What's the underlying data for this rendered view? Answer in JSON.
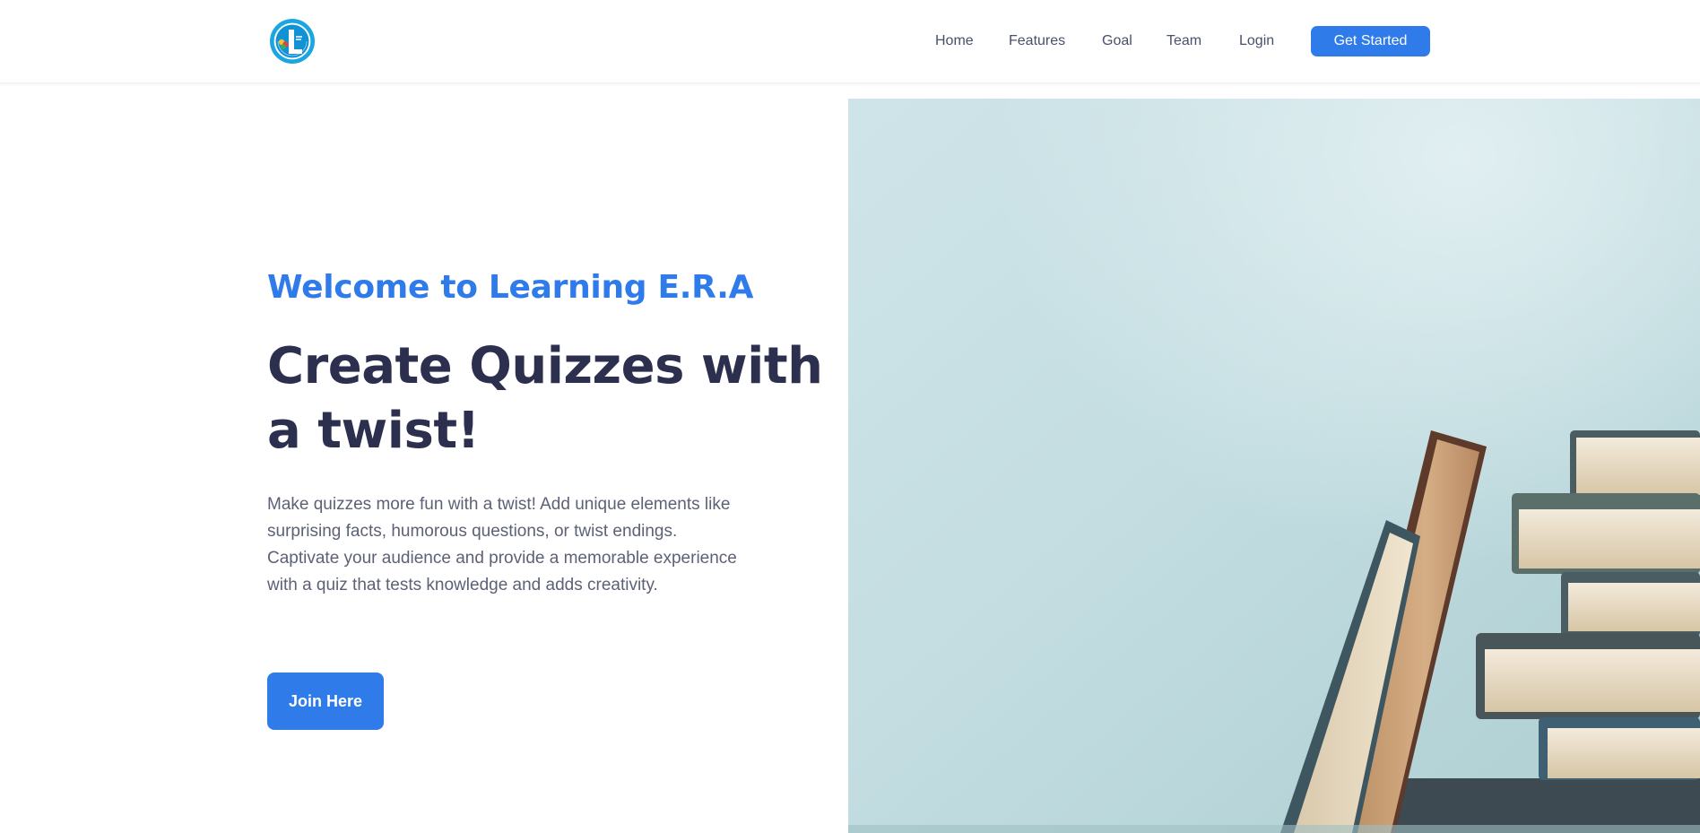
{
  "header": {
    "logo_icon": "learning-era-logo",
    "nav": {
      "home": "Home",
      "features": "Features",
      "goal": "Goal",
      "team": "Team",
      "login": "Login"
    },
    "cta_label": "Get Started"
  },
  "hero": {
    "welcome": "Welcome to Learning E.R.A",
    "headline": "Create Quizzes with a twist!",
    "description": "Make quizzes more fun with a twist! Add unique elements like surprising facts, humorous questions, or twist endings. Captivate your audience and provide a memorable experience with a quiz that tests knowledge and adds creativity.",
    "join_label": "Join Here",
    "image": "stack-of-books-photo"
  },
  "colors": {
    "accent": "#2f7bea",
    "heading": "#2c2f4e",
    "body_text": "#5d6175",
    "nav_text": "#4a4f6a",
    "photo_background": "#bcdbdf"
  }
}
